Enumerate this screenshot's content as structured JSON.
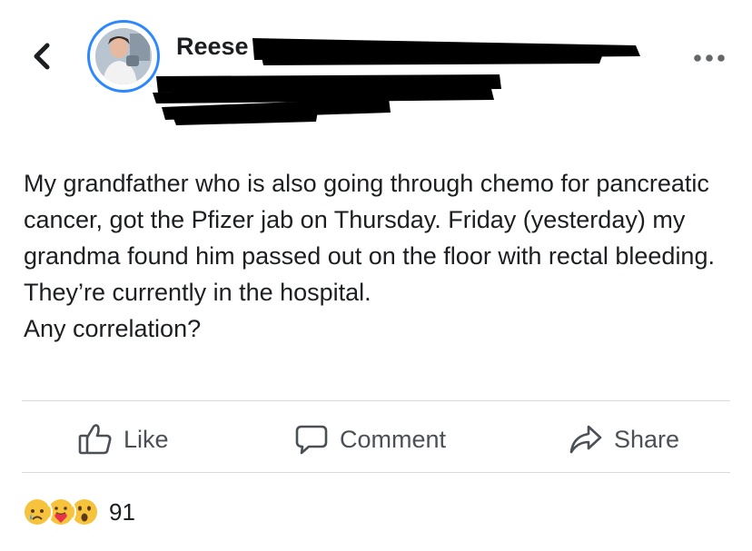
{
  "header": {
    "author_name": "Reese"
  },
  "post": {
    "paragraph_1": "My grandfather who is also going through chemo for pancreatic cancer,  got the Pfizer jab on Thursday. Friday (yesterday) my grandma found him passed out on the floor with rectal bleeding. They’re currently in the hospital.",
    "paragraph_2": "Any correlation?"
  },
  "actions": {
    "like_label": "Like",
    "comment_label": "Comment",
    "share_label": "Share"
  },
  "reactions": {
    "icons": [
      "sad-reaction-icon",
      "care-reaction-icon",
      "wow-reaction-icon"
    ],
    "count": "91"
  },
  "colors": {
    "avatar_ring": "#2d88ff",
    "text": "#1c1e21",
    "action_text": "#4b4f56",
    "divider": "#d8dadf",
    "reaction_yellow": "#f7c33c"
  }
}
